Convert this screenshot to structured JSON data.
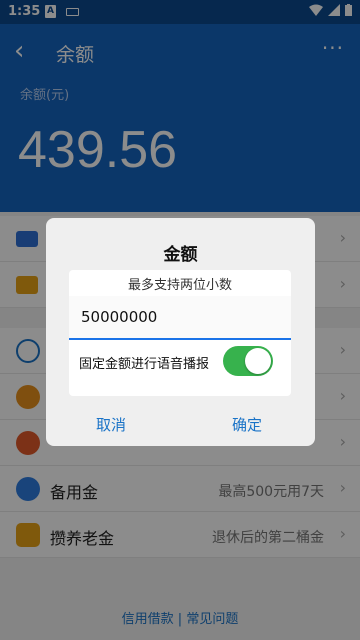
{
  "statusbar": {
    "time": "1:35",
    "a_label": "A"
  },
  "header": {
    "back_symbol": "‹",
    "title": "余额",
    "more": "···",
    "balance_label": "余额(元)",
    "balance_value": "439.56"
  },
  "list": {
    "rows": [
      {
        "label": "",
        "desc": ""
      },
      {
        "label": "",
        "desc": ""
      },
      {
        "label": "",
        "desc": ""
      },
      {
        "label": "",
        "desc": ""
      },
      {
        "label": "",
        "desc": ""
      },
      {
        "label": "备用金",
        "desc": "最高500元用7天"
      },
      {
        "label": "攒养老金",
        "desc": "退休后的第二桶金"
      }
    ]
  },
  "footer": {
    "links": "信用借款 | 常见问题"
  },
  "dialog": {
    "title": "金额",
    "hint": "最多支持两位小数",
    "amount_value": "50000000",
    "voice_label": "固定金额进行语音播报",
    "voice_toggle_on": true,
    "cancel_label": "取消",
    "ok_label": "确定"
  },
  "colors": {
    "header": "#1565c0",
    "accent": "#1a73c7",
    "toggle_on": "#37b24d"
  }
}
